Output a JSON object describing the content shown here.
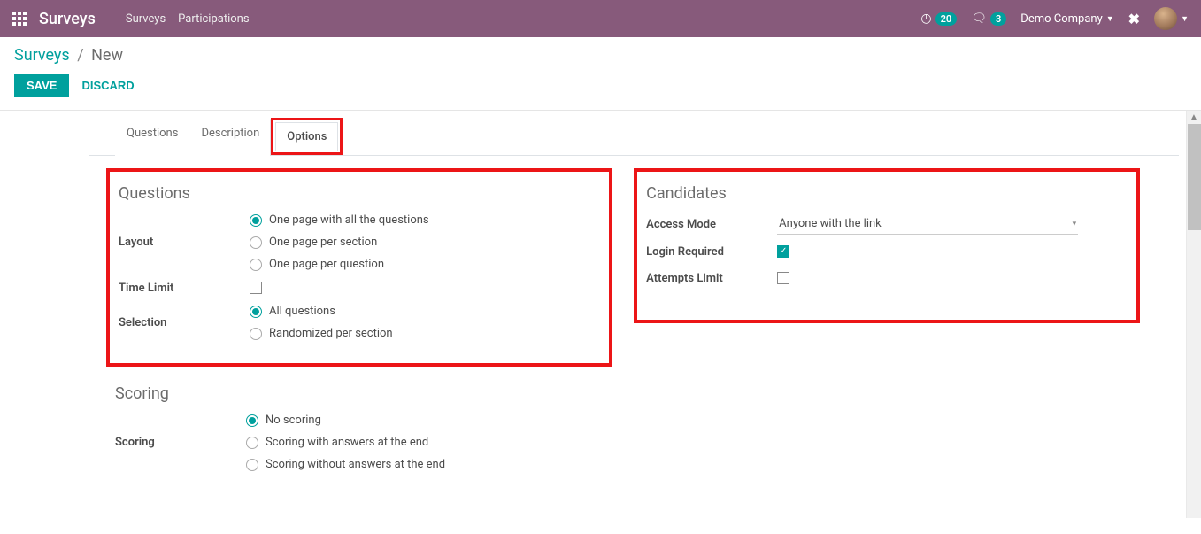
{
  "navbar": {
    "brand": "Surveys",
    "links": [
      "Surveys",
      "Participations"
    ],
    "timer_badge": "20",
    "chat_badge": "3",
    "company": "Demo Company"
  },
  "breadcrumb": {
    "root": "Surveys",
    "current": "New"
  },
  "buttons": {
    "save": "SAVE",
    "discard": "DISCARD"
  },
  "tabs": [
    "Questions",
    "Description",
    "Options"
  ],
  "active_tab": 2,
  "sections": {
    "questions": {
      "title": "Questions",
      "fields": {
        "layout": {
          "label": "Layout",
          "options": [
            "One page with all the questions",
            "One page per section",
            "One page per question"
          ],
          "selected": 0
        },
        "time_limit": {
          "label": "Time Limit",
          "checked": false
        },
        "selection": {
          "label": "Selection",
          "options": [
            "All questions",
            "Randomized per section"
          ],
          "selected": 0
        }
      }
    },
    "candidates": {
      "title": "Candidates",
      "fields": {
        "access_mode": {
          "label": "Access Mode",
          "value": "Anyone with the link"
        },
        "login_required": {
          "label": "Login Required",
          "checked": true
        },
        "attempts_limit": {
          "label": "Attempts Limit",
          "checked": false
        }
      }
    },
    "scoring": {
      "title": "Scoring",
      "fields": {
        "scoring": {
          "label": "Scoring",
          "options": [
            "No scoring",
            "Scoring with answers at the end",
            "Scoring without answers at the end"
          ],
          "selected": 0
        }
      }
    }
  }
}
